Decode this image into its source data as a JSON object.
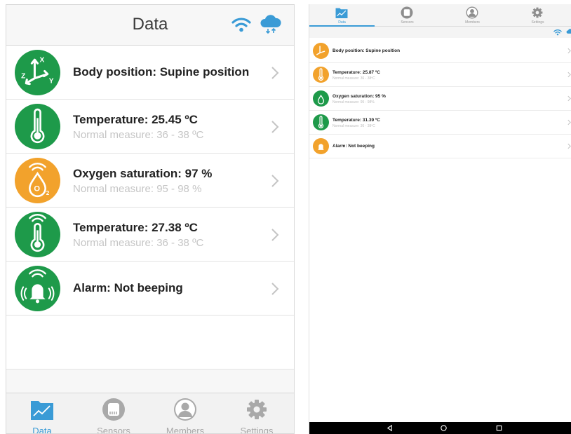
{
  "colors": {
    "green": "#1e9a4a",
    "orange": "#f2a22c",
    "accent": "#3a9bd6",
    "inactive": "#a9a9a9"
  },
  "phone": {
    "header": {
      "title": "Data",
      "wifi_icon": "wifi-icon",
      "cloud_icon": "cloud-sync-icon"
    },
    "rows": [
      {
        "title": "Body position: Supine position",
        "subtitle": "",
        "icon": "axes-icon",
        "color": "#1e9a4a"
      },
      {
        "title": "Temperature: 25.45 ºC",
        "subtitle": "Normal measure: 36 - 38 ºC",
        "icon": "thermometer-icon",
        "color": "#1e9a4a"
      },
      {
        "title": "Oxygen saturation: 97 %",
        "subtitle": "Normal measure: 95 - 98 %",
        "icon": "oxygen-drop-icon",
        "color": "#f2a22c"
      },
      {
        "title": "Temperature: 27.38 ºC",
        "subtitle": "Normal measure: 36 - 38 ºC",
        "icon": "thermometer-wireless-icon",
        "color": "#1e9a4a"
      },
      {
        "title": "Alarm: Not beeping",
        "subtitle": "",
        "icon": "bell-icon",
        "color": "#1e9a4a"
      }
    ],
    "tabs": [
      {
        "label": "Data",
        "icon": "chart-folder-icon",
        "active": true
      },
      {
        "label": "Sensors",
        "icon": "sensor-icon",
        "active": false
      },
      {
        "label": "Members",
        "icon": "person-icon",
        "active": false
      },
      {
        "label": "Settings",
        "icon": "gear-icon",
        "active": false
      }
    ]
  },
  "tablet": {
    "tabs": [
      {
        "label": "Data",
        "icon": "chart-folder-icon",
        "active": true
      },
      {
        "label": "Sensors",
        "icon": "sensor-icon",
        "active": false
      },
      {
        "label": "Members",
        "icon": "person-icon",
        "active": false
      },
      {
        "label": "Settings",
        "icon": "gear-icon",
        "active": false
      }
    ],
    "rows": [
      {
        "title": "Body position: Supine position",
        "subtitle": "",
        "icon": "axes-icon",
        "color": "#f2a22c"
      },
      {
        "title": "Temperature: 25.87 ºC",
        "subtitle": "Normal measure: 36 - 38ºC",
        "icon": "thermometer-icon",
        "color": "#f2a22c"
      },
      {
        "title": "Oxygen saturation: 95 %",
        "subtitle": "Normal measure: 95 - 98%",
        "icon": "oxygen-drop-icon",
        "color": "#1e9a4a"
      },
      {
        "title": "Temperature: 31.39 ºC",
        "subtitle": "Normal measure: 36 - 38ºC",
        "icon": "thermometer-icon",
        "color": "#1e9a4a"
      },
      {
        "title": "Alarm: Not beeping",
        "subtitle": "",
        "icon": "bell-icon",
        "color": "#f2a22c"
      }
    ],
    "nav": [
      "back-icon",
      "home-icon",
      "recents-icon"
    ]
  }
}
